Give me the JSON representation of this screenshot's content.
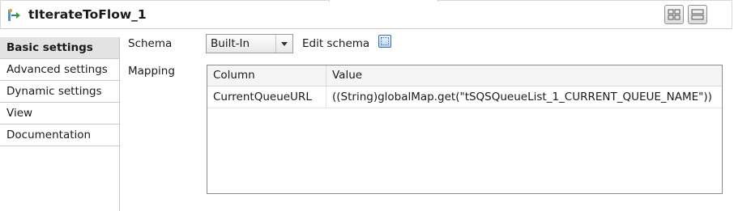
{
  "header": {
    "title": "tIterateToFlow_1",
    "component_icon": "iterate-flow-icon",
    "layout_buttons": [
      "grid-layout-icon",
      "stacked-layout-icon"
    ]
  },
  "sidebar": {
    "items": [
      {
        "label": "Basic settings",
        "active": true
      },
      {
        "label": "Advanced settings",
        "active": false
      },
      {
        "label": "Dynamic settings",
        "active": false
      },
      {
        "label": "View",
        "active": false
      },
      {
        "label": "Documentation",
        "active": false
      }
    ]
  },
  "main": {
    "schema_label": "Schema",
    "schema_value": "Built-In",
    "edit_schema_label": "Edit schema",
    "mapping_label": "Mapping",
    "table": {
      "columns": [
        "Column",
        "Value"
      ],
      "rows": [
        [
          "CurrentQueueURL",
          "((String)globalMap.get(\"tSQSQueueList_1_CURRENT_QUEUE_NAME\"))"
        ]
      ]
    }
  },
  "colors": {
    "active_tab_bg": "#e3e3e3",
    "border": "#c9c9c9",
    "icon_blue": "#3c6eb4"
  }
}
